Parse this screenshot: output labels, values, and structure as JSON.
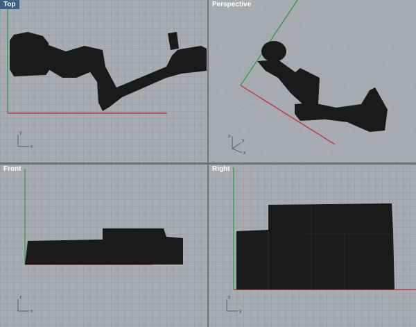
{
  "viewports": [
    {
      "id": "top",
      "label": "Top",
      "active": true,
      "axis_labels": [
        "y",
        "x"
      ]
    },
    {
      "id": "perspective",
      "label": "Perspective",
      "active": false,
      "axis_labels": [
        "z",
        "y",
        "x"
      ]
    },
    {
      "id": "front",
      "label": "Front",
      "active": false,
      "axis_labels": [
        "z",
        "x"
      ]
    },
    {
      "id": "right",
      "label": "Right",
      "active": false,
      "axis_labels": [
        "z",
        "y"
      ]
    }
  ],
  "colors": {
    "background": "#a7acb2",
    "grid": "#9ca1a7",
    "x_axis": "#c8242a",
    "y_axis": "#2a9a3a",
    "model": "#1a1a1a",
    "active_label": "#3b5f87"
  }
}
